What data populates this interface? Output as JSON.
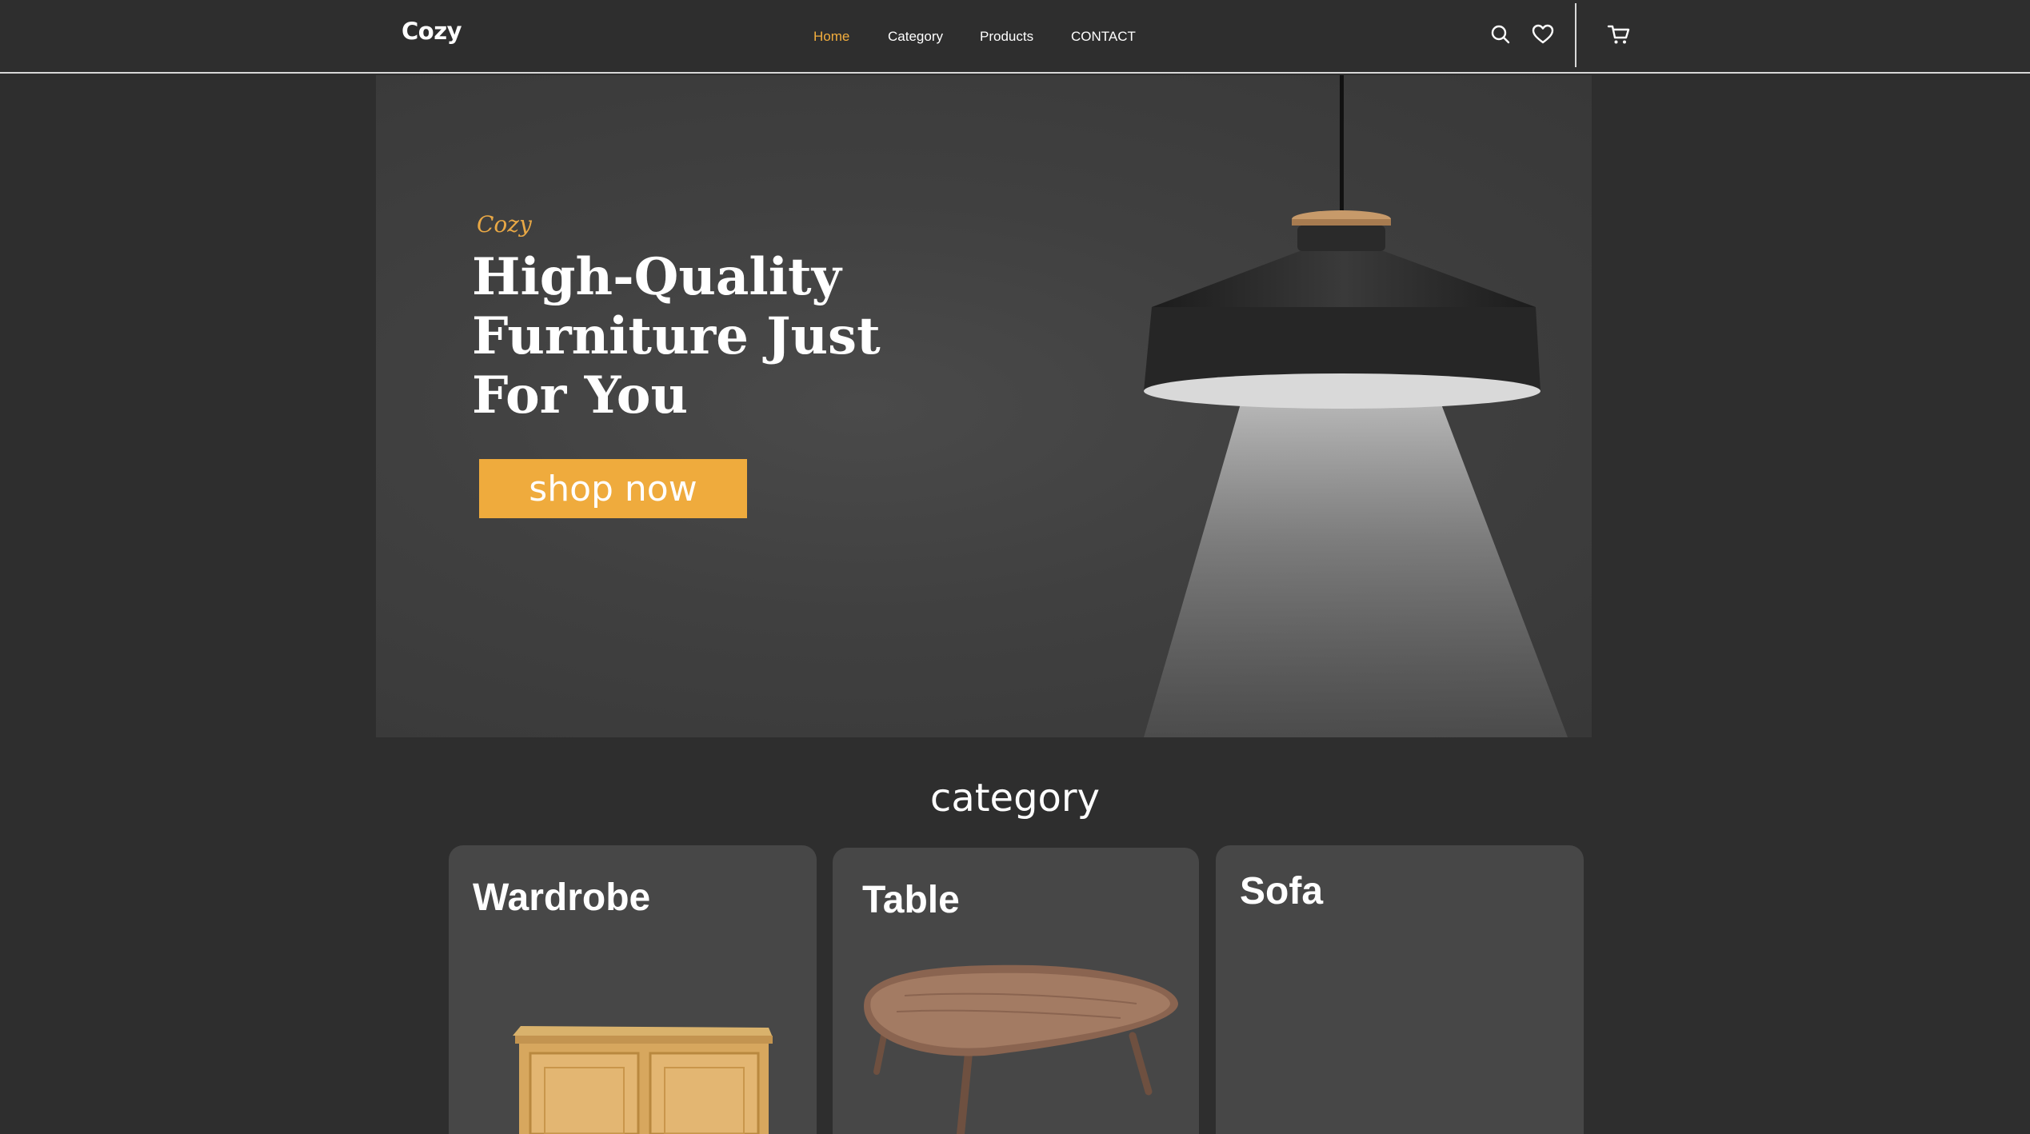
{
  "header": {
    "logo": "Cozy",
    "nav": [
      {
        "label": "Home",
        "active": true
      },
      {
        "label": "Category",
        "active": false
      },
      {
        "label": "Products",
        "active": false
      },
      {
        "label": "CONTACT",
        "active": false
      }
    ],
    "icons": [
      "search-icon",
      "heart-icon",
      "cart-icon"
    ]
  },
  "hero": {
    "brand": "Cozy",
    "title": "High-Quality Furniture Just For You",
    "button_label": "shop now"
  },
  "category": {
    "heading": "category",
    "cards": [
      {
        "title": "Wardrobe"
      },
      {
        "title": "Table"
      },
      {
        "title": "Sofa"
      }
    ]
  },
  "colors": {
    "background": "#2e2e2e",
    "accent": "#efab3d",
    "card": "#474747"
  }
}
